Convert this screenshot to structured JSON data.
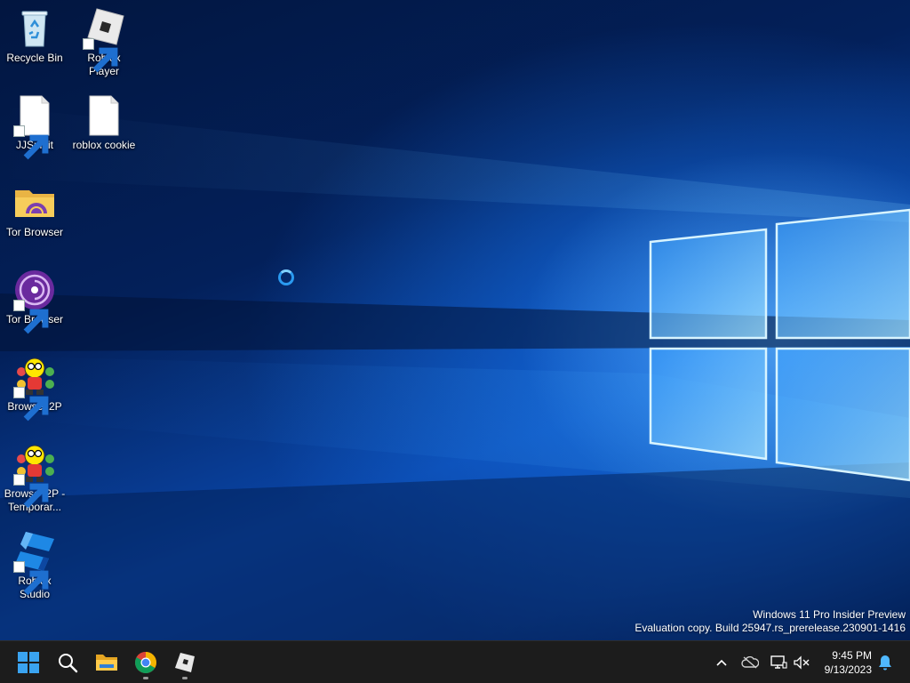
{
  "desktop": {
    "icons": [
      {
        "label": "Recycle Bin",
        "icon": "recycle-bin-icon",
        "shortcut": false
      },
      {
        "label": "Roblox Player",
        "icon": "roblox-icon",
        "shortcut": true
      },
      {
        "label": "JJSploit",
        "icon": "file-icon",
        "shortcut": true
      },
      {
        "label": "roblox cookie",
        "icon": "file-icon",
        "shortcut": false
      },
      {
        "label": "Tor Browser",
        "icon": "tor-folder-icon",
        "shortcut": false
      },
      {
        "label": "Tor Browser",
        "icon": "tor-browser-icon",
        "shortcut": true
      },
      {
        "label": "Browse I2P",
        "icon": "i2p-icon",
        "shortcut": true
      },
      {
        "label": "Browse I2P - Temporar...",
        "icon": "i2p-icon",
        "shortcut": true
      },
      {
        "label": "Roblox Studio",
        "icon": "roblox-studio-icon",
        "shortcut": true
      }
    ]
  },
  "watermark": {
    "line1": "Windows 11 Pro Insider Preview",
    "line2": "Evaluation copy. Build 25947.rs_prerelease.230901-1416"
  },
  "taskbar": {
    "apps": [
      {
        "name": "Start",
        "icon": "windows-start-icon",
        "running": false
      },
      {
        "name": "Search",
        "icon": "search-icon",
        "running": false
      },
      {
        "name": "File Explorer",
        "icon": "folder-icon",
        "running": false
      },
      {
        "name": "Google Chrome",
        "icon": "chrome-icon",
        "running": true
      },
      {
        "name": "Roblox",
        "icon": "roblox-icon",
        "running": true
      }
    ],
    "tray": {
      "icons": [
        "chevron-up-icon",
        "onedrive-offline-icon",
        "network-icon",
        "volume-muted-icon",
        "notification-bell-icon"
      ]
    },
    "clock": {
      "time": "9:45 PM",
      "date": "9/13/2023"
    }
  },
  "colors": {
    "taskbar": "#1c1c1c",
    "accent": "#0078d4",
    "wallpaper_glow": "#64c0ff"
  }
}
